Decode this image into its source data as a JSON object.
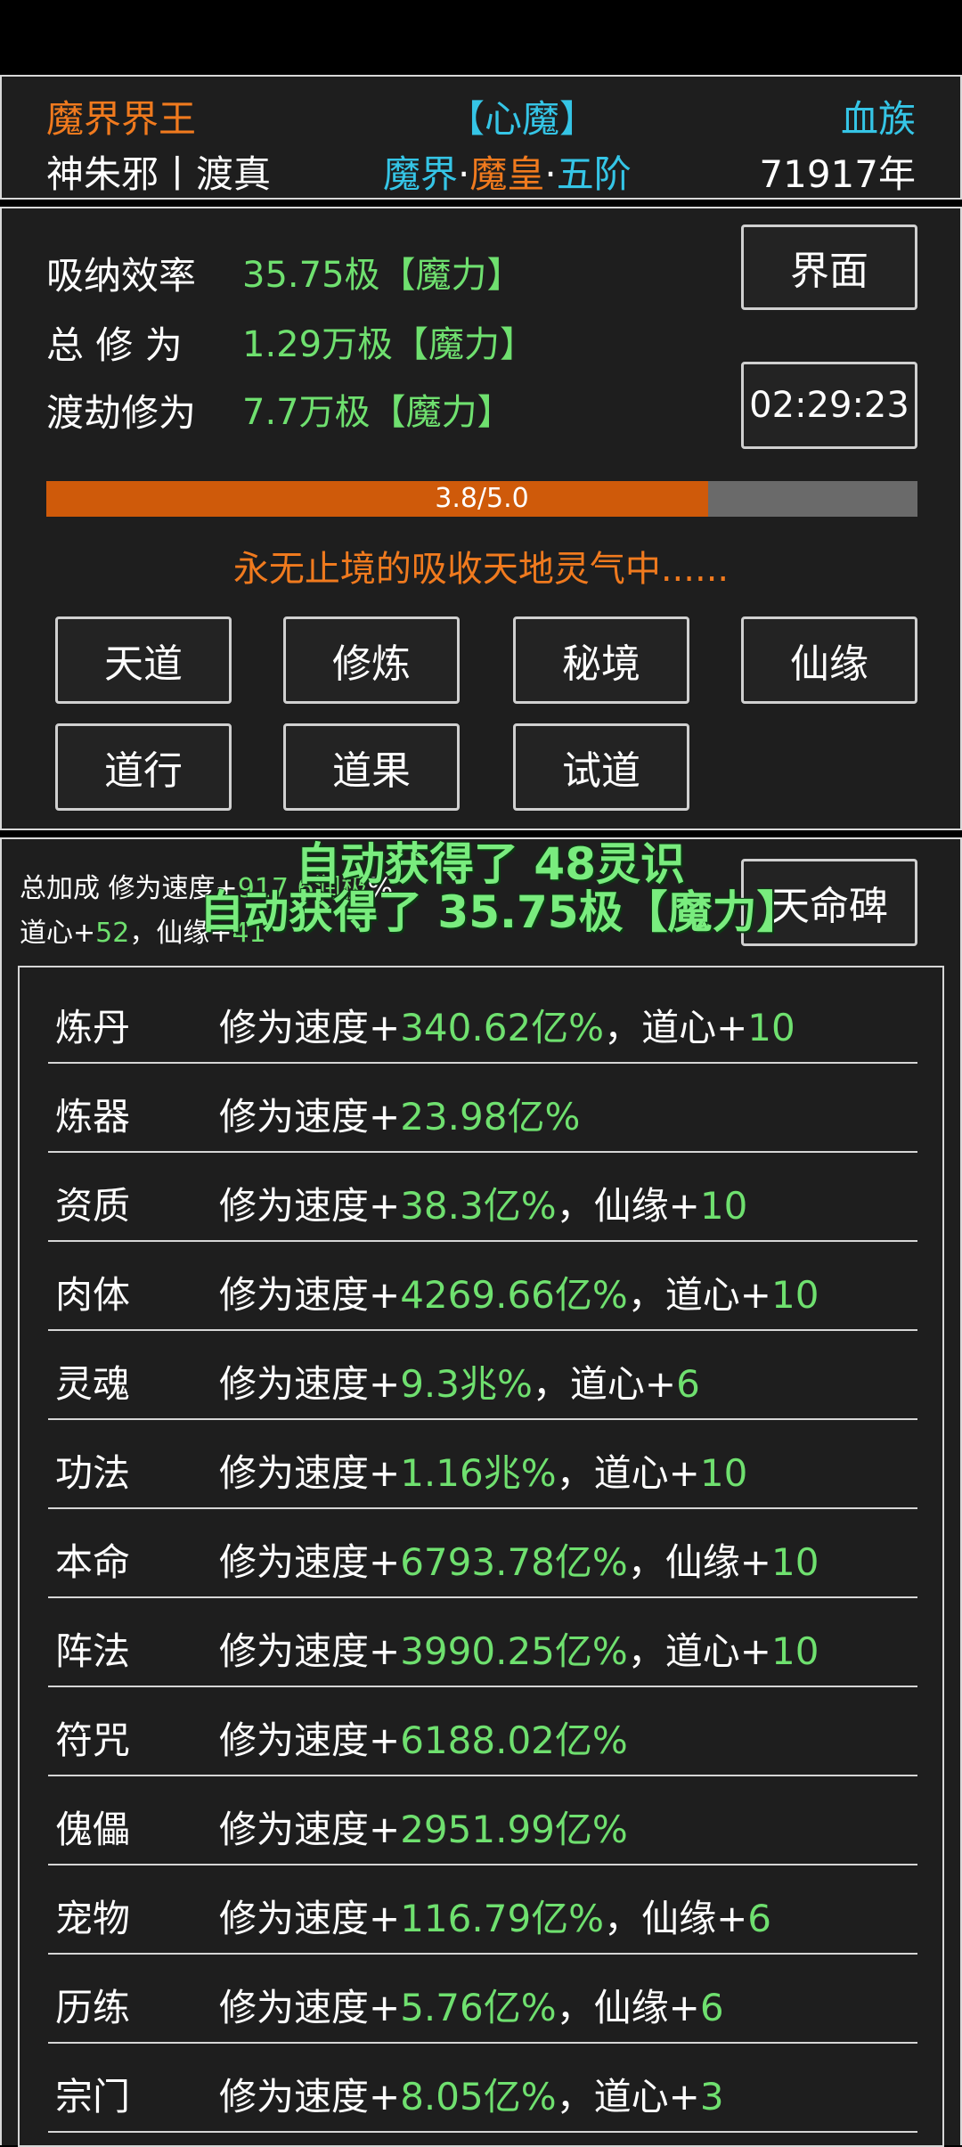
{
  "header": {
    "title": "魔界界王",
    "status": "【心魔】",
    "race": "血族",
    "name": "神朱邪丨渡真",
    "realm_world": "魔界",
    "realm_dot": "·",
    "realm_rank": "魔皇",
    "realm_stage": "五阶",
    "age": "71917年"
  },
  "stats": {
    "absorb_label": "吸纳效率",
    "absorb_value": "35.75极【魔力】",
    "total_label": "总 修 为",
    "total_value": "1.29万极【魔力】",
    "tribulation_label": "渡劫修为",
    "tribulation_value": "7.7万极【魔力】",
    "interface_button": "界面",
    "timer": "02:29:23",
    "progress_text": "3.8/5.0",
    "progress_fraction": 0.76,
    "status_message": "永无止境的吸收天地灵气中......"
  },
  "menu": [
    {
      "label": "天道"
    },
    {
      "label": "修炼"
    },
    {
      "label": "秘境"
    },
    {
      "label": "仙缘"
    },
    {
      "label": "道行"
    },
    {
      "label": "道果"
    },
    {
      "label": "试道"
    }
  ],
  "bonus": {
    "line1_prefix": "总加成 修为速度+",
    "line1_value": "917.6润极",
    "line1_suffix": "%",
    "line2_a": "道心+",
    "line2_a_val": "52",
    "line2_b": "，仙缘+",
    "line2_b_val": "41",
    "tianming_button": "天命碑"
  },
  "floating": {
    "msg1": "自动获得了 48灵识",
    "msg2": "自动获得了 35.75极【魔力】"
  },
  "list": [
    {
      "name": "炼丹",
      "prefix": "修为速度+",
      "value": "340.62亿%",
      "extra_label": "，道心+",
      "extra_value": "10"
    },
    {
      "name": "炼器",
      "prefix": "修为速度+",
      "value": "23.98亿%",
      "extra_label": "",
      "extra_value": ""
    },
    {
      "name": "资质",
      "prefix": "修为速度+",
      "value": "38.3亿%",
      "extra_label": "，仙缘+",
      "extra_value": "10"
    },
    {
      "name": "肉体",
      "prefix": "修为速度+",
      "value": "4269.66亿%",
      "extra_label": "，道心+",
      "extra_value": "10"
    },
    {
      "name": "灵魂",
      "prefix": "修为速度+",
      "value": "9.3兆%",
      "extra_label": "，道心+",
      "extra_value": "6"
    },
    {
      "name": "功法",
      "prefix": "修为速度+",
      "value": "1.16兆%",
      "extra_label": "，道心+",
      "extra_value": "10"
    },
    {
      "name": "本命",
      "prefix": "修为速度+",
      "value": "6793.78亿%",
      "extra_label": "，仙缘+",
      "extra_value": "10"
    },
    {
      "name": "阵法",
      "prefix": "修为速度+",
      "value": "3990.25亿%",
      "extra_label": "，道心+",
      "extra_value": "10"
    },
    {
      "name": "符咒",
      "prefix": "修为速度+",
      "value": "6188.02亿%",
      "extra_label": "",
      "extra_value": ""
    },
    {
      "name": "傀儡",
      "prefix": "修为速度+",
      "value": "2951.99亿%",
      "extra_label": "",
      "extra_value": ""
    },
    {
      "name": "宠物",
      "prefix": "修为速度+",
      "value": "116.79亿%",
      "extra_label": "，仙缘+",
      "extra_value": "6"
    },
    {
      "name": "历练",
      "prefix": "修为速度+",
      "value": "5.76亿%",
      "extra_label": "，仙缘+",
      "extra_value": "6"
    },
    {
      "name": "宗门",
      "prefix": "修为速度+",
      "value": "8.05亿%",
      "extra_label": "，道心+",
      "extra_value": "3"
    }
  ]
}
